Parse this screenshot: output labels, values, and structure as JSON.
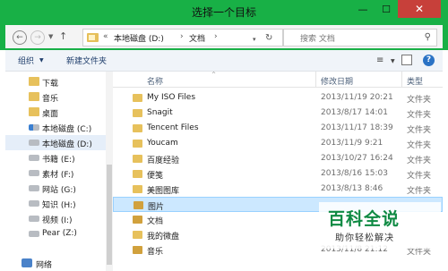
{
  "window": {
    "title": "选择一个目标",
    "minimize_glyph": "—",
    "maximize_glyph": "☐",
    "close_glyph": "✕"
  },
  "address": {
    "back_glyph": "←",
    "forward_glyph": "→",
    "history_glyph": "▼",
    "up_glyph": "↑",
    "overflow": "«",
    "crumbs": [
      "本地磁盘 (D:)",
      "文档"
    ],
    "separator": "›",
    "dropdown_glyph": "▾",
    "refresh_glyph": "↻",
    "search_placeholder": "搜索 文档",
    "search_glyph": "⚲"
  },
  "toolbar": {
    "organize": "组织",
    "organize_arrow": "▼",
    "new_folder": "新建文件夹",
    "view_glyph": "≡",
    "view_arrow": "▼",
    "help": "?"
  },
  "nav": {
    "items": [
      {
        "label": "下载",
        "icon": "downloads-folder-icon",
        "kind": "folder"
      },
      {
        "label": "音乐",
        "icon": "music-folder-icon",
        "kind": "folder"
      },
      {
        "label": "桌面",
        "icon": "desktop-folder-icon",
        "kind": "folder"
      },
      {
        "label": "本地磁盘 (C:)",
        "icon": "system-drive-icon",
        "kind": "drive-c"
      },
      {
        "label": "本地磁盘 (D:)",
        "icon": "drive-icon",
        "kind": "drive",
        "selected": true
      },
      {
        "label": "书籍 (E:)",
        "icon": "drive-icon",
        "kind": "drive"
      },
      {
        "label": "素材 (F:)",
        "icon": "drive-icon",
        "kind": "drive"
      },
      {
        "label": "网站 (G:)",
        "icon": "drive-icon",
        "kind": "drive"
      },
      {
        "label": "知识 (H:)",
        "icon": "drive-icon",
        "kind": "drive"
      },
      {
        "label": "视频 (I:)",
        "icon": "drive-icon",
        "kind": "drive"
      },
      {
        "label": "Pear (Z:)",
        "icon": "drive-icon",
        "kind": "drive"
      },
      {
        "label": "网络",
        "icon": "network-icon",
        "kind": "net"
      }
    ]
  },
  "files": {
    "headers": {
      "name": "名称",
      "date": "修改日期",
      "type": "类型",
      "sort_glyph": "^"
    },
    "rows": [
      {
        "name": "My ISO Files",
        "date": "2013/11/19 20:21",
        "type": "文件夹",
        "kind": "folder"
      },
      {
        "name": "Snagit",
        "date": "2013/8/17 14:01",
        "type": "文件夹",
        "kind": "folder"
      },
      {
        "name": "Tencent Files",
        "date": "2013/11/17 18:39",
        "type": "文件夹",
        "kind": "folder"
      },
      {
        "name": "Youcam",
        "date": "2013/11/9 9:21",
        "type": "文件夹",
        "kind": "folder"
      },
      {
        "name": "百度经验",
        "date": "2013/10/27 16:24",
        "type": "文件夹",
        "kind": "folder"
      },
      {
        "name": "便笺",
        "date": "2013/8/16 15:03",
        "type": "文件夹",
        "kind": "folder"
      },
      {
        "name": "美图图库",
        "date": "2013/8/13 8:46",
        "type": "文件夹",
        "kind": "folder"
      },
      {
        "name": "图片",
        "date": "",
        "type": "",
        "kind": "lib",
        "selected": true
      },
      {
        "name": "文档",
        "date": "",
        "type": "",
        "kind": "lib"
      },
      {
        "name": "我的微盘",
        "date": "",
        "type": "",
        "kind": "folder"
      },
      {
        "name": "音乐",
        "date": "2013/11/8 21:12",
        "type": "文件夹",
        "kind": "lib"
      }
    ]
  },
  "watermark": {
    "logo": "百科全说",
    "slogan": "助你轻松解决"
  }
}
